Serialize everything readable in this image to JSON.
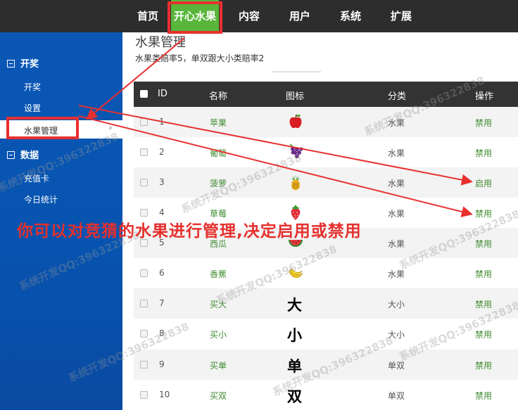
{
  "topnav": {
    "items": [
      {
        "label": "首页",
        "active": false
      },
      {
        "label": "开心水果",
        "active": true
      },
      {
        "label": "内容",
        "active": false
      },
      {
        "label": "用户",
        "active": false
      },
      {
        "label": "系统",
        "active": false
      },
      {
        "label": "扩展",
        "active": false
      }
    ]
  },
  "sidebar": {
    "groups": [
      {
        "label": "开奖",
        "items": [
          "开奖",
          "设置",
          "水果管理"
        ]
      },
      {
        "label": "数据",
        "items": [
          "充值卡",
          "今日统计"
        ]
      }
    ],
    "active_item": "水果管理"
  },
  "main": {
    "title": "水果管理",
    "subtitle": "水果类赔率5，单双跟大小类赔率2"
  },
  "table": {
    "headers": {
      "id": "ID",
      "name": "名称",
      "icon": "图标",
      "category": "分类",
      "action": "操作"
    },
    "rows": [
      {
        "id": "1",
        "name": "苹果",
        "icon": "apple-icon",
        "category": "水果",
        "action": "禁用"
      },
      {
        "id": "2",
        "name": "葡萄",
        "icon": "grape-icon",
        "category": "水果",
        "action": "禁用"
      },
      {
        "id": "3",
        "name": "菠萝",
        "icon": "pineapple-icon",
        "category": "水果",
        "action": "启用"
      },
      {
        "id": "4",
        "name": "草莓",
        "icon": "strawberry-icon",
        "category": "水果",
        "action": "禁用"
      },
      {
        "id": "5",
        "name": "西瓜",
        "icon": "watermelon-icon",
        "category": "水果",
        "action": "禁用"
      },
      {
        "id": "6",
        "name": "香蕉",
        "icon": "banana-icon",
        "category": "水果",
        "action": "禁用"
      },
      {
        "id": "7",
        "name": "买大",
        "icon": "大",
        "category": "大小",
        "action": "禁用"
      },
      {
        "id": "8",
        "name": "买小",
        "icon": "小",
        "category": "大小",
        "action": "禁用"
      },
      {
        "id": "9",
        "name": "买单",
        "icon": "单",
        "category": "单双",
        "action": "禁用"
      },
      {
        "id": "10",
        "name": "买双",
        "icon": "双",
        "category": "单双",
        "action": "禁用"
      }
    ]
  },
  "annotation": "你可以对竞猜的水果进行管理,决定启用或禁用",
  "watermark": "系统开发QQ:396322838",
  "colors": {
    "accent_green": "#59b63b",
    "highlight_red": "#e8302f",
    "sidebar_blue": "#0754b0",
    "topbar_dark": "#2d2d2d"
  }
}
